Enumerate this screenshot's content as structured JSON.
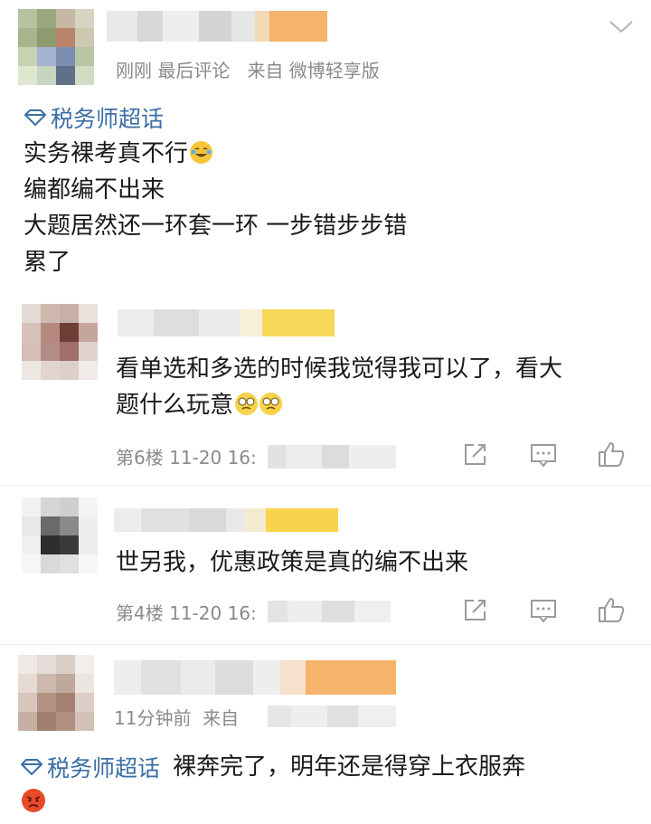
{
  "comment_main": {
    "time": "刚刚",
    "last_comment": "最后评论",
    "source_prefix": "来自",
    "source": "微博轻享版",
    "topic_tag": "税务师超话",
    "lines": [
      "实务裸考真不行",
      "编都编不出来",
      "大题居然还一环套一环  一步错步步错",
      "累了"
    ]
  },
  "replies": [
    {
      "text_line1": "看单选和多选的时候我觉得我可以了，看大",
      "text_line2": "题什么玩意",
      "floor": "第6楼",
      "time": "11-20 16:"
    },
    {
      "text_line1": "世另我，优惠政策是真的编不出来",
      "floor": "第4楼",
      "time": "11-20 16:"
    }
  ],
  "comment_last": {
    "time": "11分钟前",
    "source_prefix": "来自",
    "topic_tag": "税务师超话",
    "text": "裸奔完了，明年还是得穿上衣服奔"
  },
  "colors": {
    "link": "#3a6ea5",
    "meta": "#8a8a8a",
    "name_highlight": "#f5b36b"
  },
  "icons": [
    "chevron-down-icon",
    "diamond-icon",
    "share-icon",
    "comment-icon",
    "like-icon"
  ]
}
